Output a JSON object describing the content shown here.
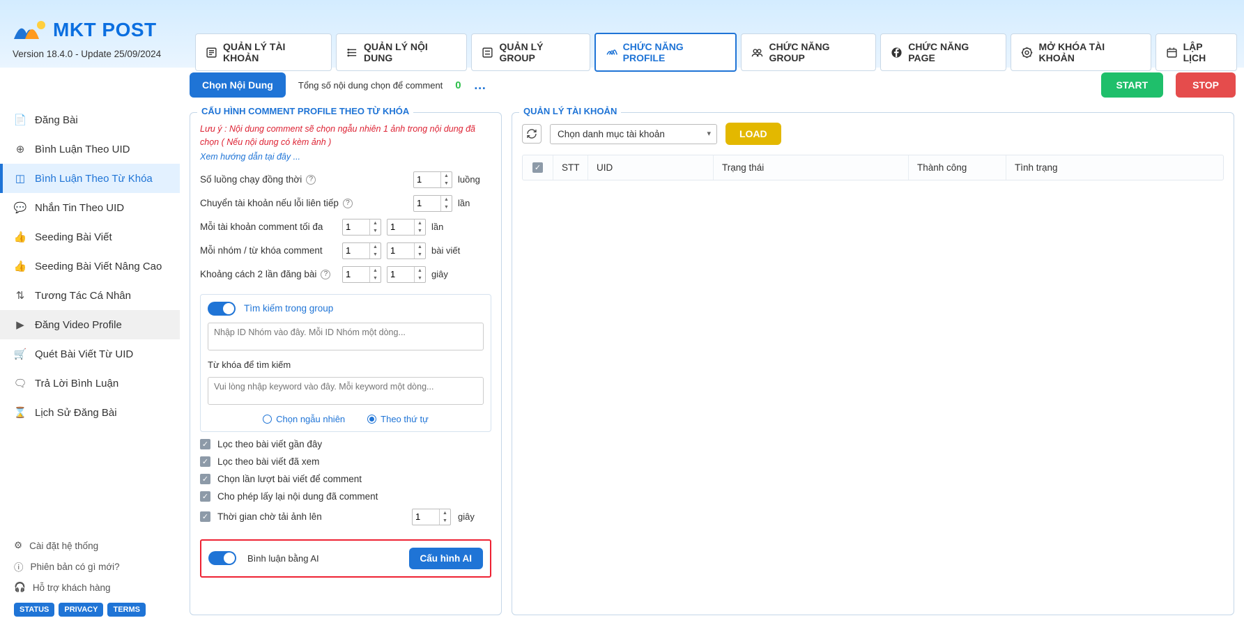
{
  "brand": {
    "name": "MKT POST",
    "version": "Version  18.4.0  -  Update  25/09/2024"
  },
  "tabs": [
    {
      "label": "QUẢN LÝ TÀI KHOẢN"
    },
    {
      "label": "QUẢN LÝ NỘI DUNG"
    },
    {
      "label": "QUẢN LÝ GROUP"
    },
    {
      "label": "CHỨC NĂNG PROFILE",
      "active": true
    },
    {
      "label": "CHỨC NĂNG GROUP"
    },
    {
      "label": "CHỨC NĂNG PAGE"
    },
    {
      "label": "MỞ KHÓA TÀI KHOẢN"
    },
    {
      "label": "LẬP LỊCH"
    }
  ],
  "toolbar": {
    "choose_content": "Chọn Nội Dung",
    "total_label": "Tổng số nội dung chọn để comment",
    "count": "0",
    "start": "START",
    "stop": "STOP"
  },
  "sidebar": {
    "items": [
      "Đăng Bài",
      "Bình Luận Theo UID",
      "Bình Luận Theo Từ Khóa",
      "Nhắn Tin Theo UID",
      "Seeding Bài Viết",
      "Seeding Bài Viết Nâng Cao",
      "Tương Tác Cá Nhân",
      "Đăng Video Profile",
      "Quét Bài Viết Từ UID",
      "Trả Lời Bình Luận",
      "Lịch Sử Đăng Bài"
    ],
    "footer": [
      "Cài đặt hệ thống",
      "Phiên bản có gì mới?",
      "Hỗ trợ khách hàng"
    ],
    "badges": [
      "STATUS",
      "PRIVACY",
      "TERMS"
    ]
  },
  "config": {
    "panel_title": "CẤU HÌNH COMMENT PROFILE THEO TỪ KHÓA",
    "note1": "Lưu ý : Nội dung comment sẽ chọn ngẫu nhiên 1 ảnh trong nội dung đã chọn ( Nếu nội dung có kèm ảnh )",
    "hint": "Xem hướng dẫn tại đây ...",
    "rows": {
      "threads": {
        "label": "Số luồng chạy đồng thời",
        "v1": "1",
        "unit": "luồng"
      },
      "switch": {
        "label": "Chuyển tài khoản nếu lỗi liên tiếp",
        "v1": "1",
        "unit": "lần"
      },
      "maxcmt": {
        "label": "Mỗi tài khoản comment tối đa",
        "v1": "1",
        "v2": "1",
        "unit": "lần"
      },
      "pergrp": {
        "label": "Mỗi nhóm / từ khóa comment",
        "v1": "1",
        "v2": "1",
        "unit": "bài viết"
      },
      "gap": {
        "label": "Khoảng cách 2 lần đăng bài",
        "v1": "1",
        "v2": "1",
        "unit": "giây"
      }
    },
    "search_group": "Tìm kiếm trong group",
    "group_ph": "Nhập ID Nhóm vào đây. Mỗi ID Nhóm một dòng...",
    "kw_label": "Từ khóa để tìm kiếm",
    "kw_ph": "Vui lòng nhập keyword vào đây. Mỗi keyword một dòng...",
    "radio_random": "Chọn ngẫu nhiên",
    "radio_order": "Theo thứ tự",
    "checks": [
      "Lọc theo bài viết gần đây",
      "Lọc theo bài viết đã xem",
      "Chọn lần lượt bài viết để comment",
      "Cho phép lấy lại nội dung đã comment"
    ],
    "imgwait": {
      "label": "Thời gian chờ tải ảnh lên",
      "v": "1",
      "unit": "giây"
    },
    "ai_toggle": "Bình luận bằng AI",
    "ai_btn": "Cấu hình AI"
  },
  "accounts": {
    "panel_title": "QUẢN LÝ TÀI KHOẢN",
    "select_label": "Chọn danh mục tài khoản",
    "load": "LOAD",
    "cols": [
      "STT",
      "UID",
      "Trạng thái",
      "Thành công",
      "Tình trạng"
    ]
  }
}
